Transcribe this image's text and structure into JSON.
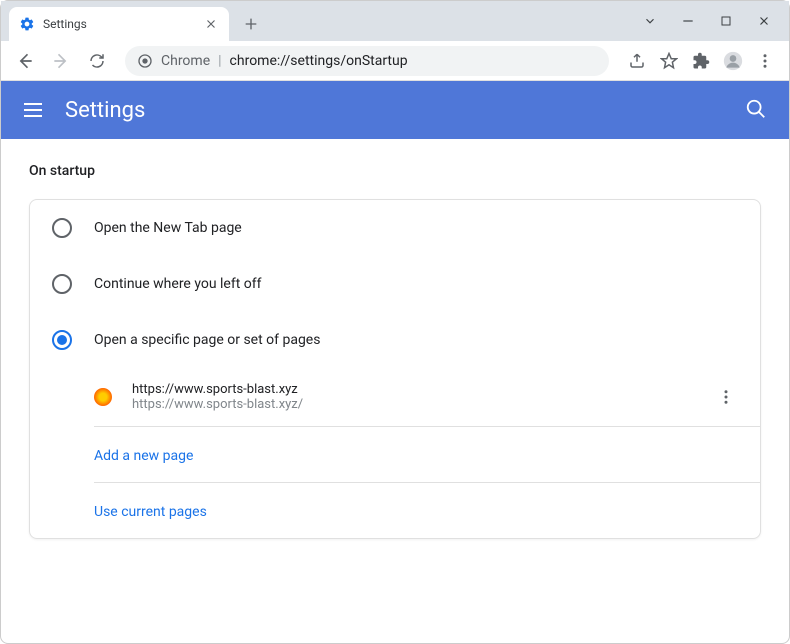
{
  "tab": {
    "title": "Settings"
  },
  "omnibox": {
    "prefix": "Chrome",
    "url": "chrome://settings/onStartup"
  },
  "header": {
    "title": "Settings"
  },
  "section": {
    "title": "On startup"
  },
  "options": {
    "open_new_tab": "Open the New Tab page",
    "continue": "Continue where you left off",
    "specific": "Open a specific page or set of pages"
  },
  "page": {
    "title": "https://www.sports-blast.xyz",
    "url": "https://www.sports-blast.xyz/"
  },
  "actions": {
    "add_page": "Add a new page",
    "use_current": "Use current pages"
  }
}
